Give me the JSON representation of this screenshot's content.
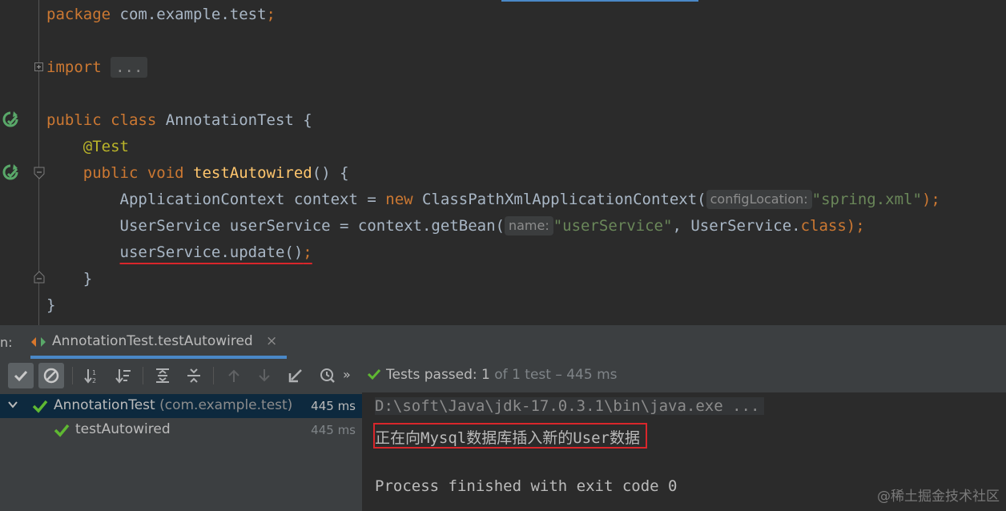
{
  "editor": {
    "lines": [
      {
        "parts": [
          {
            "t": "package ",
            "c": "kw"
          },
          {
            "t": "com.example.test",
            "c": "plain"
          },
          {
            "t": ";",
            "c": "kw"
          }
        ]
      },
      {
        "parts": [
          {
            "t": "import ",
            "c": "kw"
          },
          {
            "t": "...",
            "c": "dots"
          }
        ]
      },
      {
        "parts": [
          {
            "t": "public class ",
            "c": "kw"
          },
          {
            "t": "AnnotationTest {",
            "c": "plain"
          }
        ]
      },
      {
        "parts": [
          {
            "t": "    ",
            "c": "plain"
          },
          {
            "t": "@Test",
            "c": "ann"
          }
        ]
      },
      {
        "parts": [
          {
            "t": "    public void ",
            "c": "kw"
          },
          {
            "t": "testAutowired",
            "c": "fn"
          },
          {
            "t": "() {",
            "c": "plain"
          }
        ]
      },
      {
        "parts": [
          {
            "t": "        ApplicationContext context = ",
            "c": "plain"
          },
          {
            "t": "new ",
            "c": "kw"
          },
          {
            "t": "ClassPathXmlApplicationContext(",
            "c": "plain"
          },
          {
            "t": "configLocation:",
            "c": "hint"
          },
          {
            "t": "\"spring.xml\"",
            "c": "str"
          },
          {
            "t": ");",
            "c": "kw"
          }
        ]
      },
      {
        "parts": [
          {
            "t": "        UserService userService = context.getBean(",
            "c": "plain"
          },
          {
            "t": "name:",
            "c": "hint"
          },
          {
            "t": "\"userService\"",
            "c": "str"
          },
          {
            "t": ", UserService.",
            "c": "plain"
          },
          {
            "t": "class",
            "c": "kw"
          },
          {
            "t": ");",
            "c": "kw"
          }
        ]
      },
      {
        "parts": [
          {
            "t": "        ",
            "c": "plain"
          },
          {
            "t": "userService.update()",
            "c": "squiggle"
          },
          {
            "t": ";",
            "c": "kwsq"
          }
        ]
      },
      {
        "parts": [
          {
            "t": "    }",
            "c": "plain"
          }
        ]
      },
      {
        "parts": [
          {
            "t": "}",
            "c": "plain"
          }
        ]
      }
    ]
  },
  "run": {
    "prefix": "n:",
    "tab_label": "AnnotationTest.testAutowired",
    "close_glyph": "×",
    "status_prefix": "Tests passed: ",
    "status_count": "1",
    "status_rest": " of 1 test – 445 ms",
    "more_glyph": "»",
    "tree": [
      {
        "name": "AnnotationTest",
        "pkg": " (com.example.test)",
        "time": "445 ms"
      },
      {
        "name": "testAutowired",
        "pkg": "",
        "time": "445 ms"
      }
    ],
    "console": {
      "cmd": "D:\\soft\\Java\\jdk-17.0.3.1\\bin\\java.exe ...",
      "output": "正在向Mysql数据库插入新的User数据",
      "exit": "Process finished with exit code 0"
    }
  },
  "watermark": "@稀土掘金技术社区",
  "colors": {
    "accent": "#4a88c7",
    "pass": "#5fb832",
    "error": "#d9262b"
  }
}
